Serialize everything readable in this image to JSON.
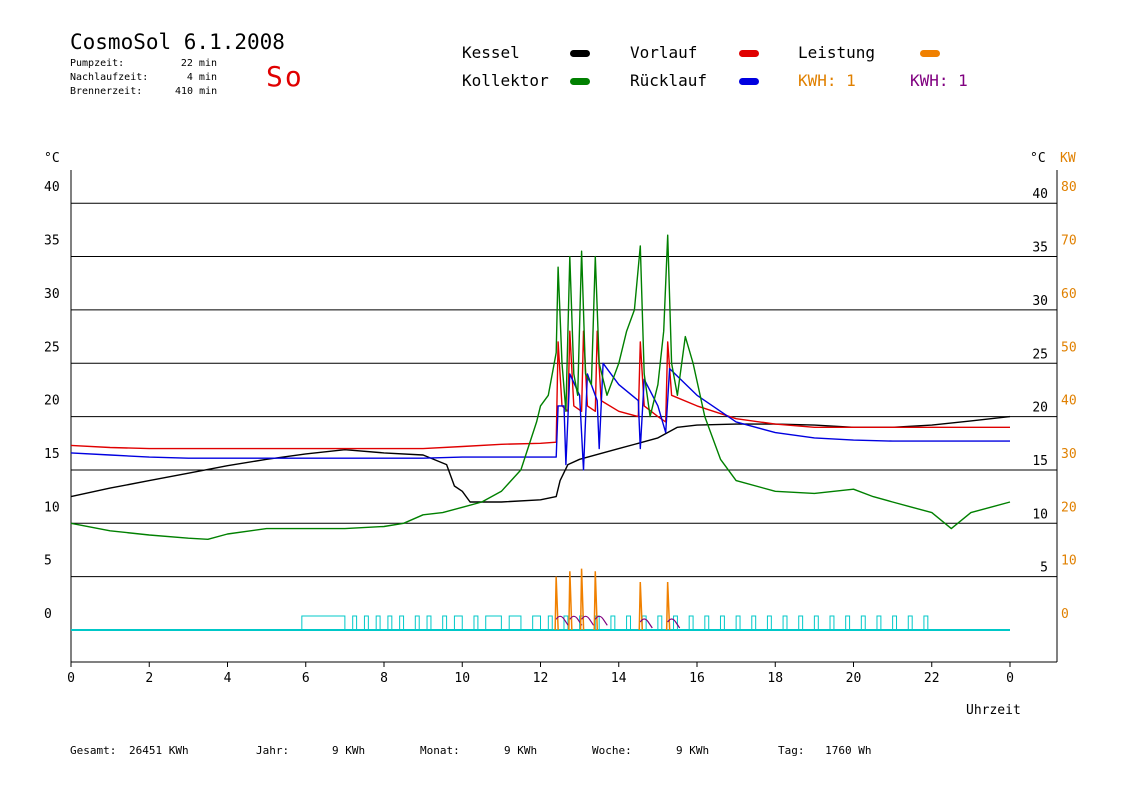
{
  "header": {
    "title": "CosmoSol 6.1.2008",
    "day": "So",
    "stats": [
      {
        "label": "Pumpzeit:",
        "value": "22 min"
      },
      {
        "label": "Nachlaufzeit:",
        "value": "4 min"
      },
      {
        "label": "Brennerzeit:",
        "value": "410 min"
      }
    ]
  },
  "legend": [
    {
      "label": "Kessel",
      "color": "#000000"
    },
    {
      "label": "Vorlauf",
      "color": "#e00000"
    },
    {
      "label": "Leistung",
      "color": "#f08000"
    },
    {
      "label": "Kollektor",
      "color": "#008000"
    },
    {
      "label": "Rücklauf",
      "color": "#0000e0"
    },
    {
      "label": "KWH: 1",
      "color": "#e08000"
    },
    {
      "label": "KWH: 1",
      "color": "#800080"
    }
  ],
  "footer": [
    {
      "label": "Gesamt:",
      "value": "26451 KWh"
    },
    {
      "label": "Jahr:",
      "value": "9 KWh"
    },
    {
      "label": "Monat:",
      "value": "9 KWh"
    },
    {
      "label": "Woche:",
      "value": "9 KWh"
    },
    {
      "label": "Tag:",
      "value": "1760 Wh"
    }
  ],
  "chart_data": {
    "type": "line",
    "xlabel": "Uhrzeit",
    "ylabel_left": "°C",
    "ylabel_right": "°C",
    "ylabel_right2": "KW",
    "xlim": [
      0,
      24
    ],
    "ylim": [
      0,
      45
    ],
    "x_ticks": [
      "0",
      "2",
      "4",
      "6",
      "8",
      "10",
      "12",
      "14",
      "16",
      "18",
      "20",
      "22",
      "0"
    ],
    "y_ticks": [
      0,
      5,
      10,
      15,
      20,
      25,
      30,
      35,
      40
    ],
    "y_right_ticks": [
      5,
      10,
      15,
      20,
      25,
      30,
      35,
      40
    ],
    "y_right2_ticks": [
      0,
      10,
      20,
      30,
      40,
      50,
      60,
      70,
      80
    ],
    "grid": "horizontal",
    "series": [
      {
        "name": "Kessel",
        "color": "#000000",
        "points": [
          [
            0,
            12.5
          ],
          [
            1,
            13.3
          ],
          [
            2,
            14.0
          ],
          [
            3,
            14.7
          ],
          [
            4,
            15.4
          ],
          [
            5,
            16.0
          ],
          [
            6,
            16.5
          ],
          [
            7,
            16.9
          ],
          [
            8,
            16.6
          ],
          [
            9,
            16.4
          ],
          [
            9.6,
            15.5
          ],
          [
            9.8,
            13.5
          ],
          [
            10,
            13.0
          ],
          [
            10.2,
            12.0
          ],
          [
            11,
            12.0
          ],
          [
            12,
            12.2
          ],
          [
            12.4,
            12.5
          ],
          [
            12.5,
            14.0
          ],
          [
            12.7,
            15.5
          ],
          [
            13,
            16.0
          ],
          [
            13.5,
            16.5
          ],
          [
            14,
            17.0
          ],
          [
            14.5,
            17.5
          ],
          [
            15,
            18.0
          ],
          [
            15.5,
            19.0
          ],
          [
            16,
            19.2
          ],
          [
            17,
            19.3
          ],
          [
            18,
            19.3
          ],
          [
            19,
            19.2
          ],
          [
            20,
            19.0
          ],
          [
            21,
            19.0
          ],
          [
            22,
            19.2
          ],
          [
            23,
            19.6
          ],
          [
            24,
            20.0
          ]
        ]
      },
      {
        "name": "Vorlauf",
        "color": "#e00000",
        "points": [
          [
            0,
            17.3
          ],
          [
            1,
            17.1
          ],
          [
            2,
            17.0
          ],
          [
            3,
            17.0
          ],
          [
            4,
            17.0
          ],
          [
            5,
            17.0
          ],
          [
            6,
            17.0
          ],
          [
            7,
            17.0
          ],
          [
            8,
            17.0
          ],
          [
            9,
            17.0
          ],
          [
            10,
            17.2
          ],
          [
            11,
            17.4
          ],
          [
            12,
            17.5
          ],
          [
            12.4,
            17.6
          ],
          [
            12.45,
            27.0
          ],
          [
            12.55,
            21.0
          ],
          [
            12.7,
            20.5
          ],
          [
            12.75,
            28.0
          ],
          [
            12.85,
            21.0
          ],
          [
            13.05,
            20.5
          ],
          [
            13.1,
            28.0
          ],
          [
            13.2,
            21.0
          ],
          [
            13.4,
            20.5
          ],
          [
            13.45,
            28.0
          ],
          [
            13.55,
            21.5
          ],
          [
            14,
            20.5
          ],
          [
            14.5,
            20.0
          ],
          [
            14.55,
            27.0
          ],
          [
            14.65,
            21.0
          ],
          [
            15,
            20.0
          ],
          [
            15.2,
            19.5
          ],
          [
            15.25,
            27.0
          ],
          [
            15.35,
            22.0
          ],
          [
            16,
            21.0
          ],
          [
            17,
            19.8
          ],
          [
            18,
            19.3
          ],
          [
            19,
            19.0
          ],
          [
            20,
            19.0
          ],
          [
            21,
            19.0
          ],
          [
            22,
            19.0
          ],
          [
            23,
            19.0
          ],
          [
            24,
            19.0
          ]
        ]
      },
      {
        "name": "Rücklauf",
        "color": "#0000e0",
        "points": [
          [
            0,
            16.6
          ],
          [
            1,
            16.4
          ],
          [
            2,
            16.2
          ],
          [
            3,
            16.1
          ],
          [
            4,
            16.1
          ],
          [
            5,
            16.1
          ],
          [
            6,
            16.1
          ],
          [
            7,
            16.1
          ],
          [
            8,
            16.1
          ],
          [
            9,
            16.1
          ],
          [
            10,
            16.2
          ],
          [
            11,
            16.2
          ],
          [
            12,
            16.2
          ],
          [
            12.4,
            16.2
          ],
          [
            12.45,
            21.0
          ],
          [
            12.6,
            21.0
          ],
          [
            12.65,
            15.5
          ],
          [
            12.75,
            24.0
          ],
          [
            13,
            22.0
          ],
          [
            13.1,
            15.0
          ],
          [
            13.2,
            24.0
          ],
          [
            13.45,
            21.5
          ],
          [
            13.5,
            17.0
          ],
          [
            13.6,
            25.0
          ],
          [
            14,
            23.0
          ],
          [
            14.5,
            21.5
          ],
          [
            14.55,
            17.0
          ],
          [
            14.65,
            23.5
          ],
          [
            15,
            21.0
          ],
          [
            15.2,
            18.5
          ],
          [
            15.3,
            24.5
          ],
          [
            16,
            22.0
          ],
          [
            17,
            19.5
          ],
          [
            18,
            18.5
          ],
          [
            19,
            18.0
          ],
          [
            20,
            17.8
          ],
          [
            21,
            17.7
          ],
          [
            22,
            17.7
          ],
          [
            23,
            17.7
          ],
          [
            24,
            17.7
          ]
        ]
      },
      {
        "name": "Kollektor",
        "color": "#008000",
        "points": [
          [
            0,
            10.0
          ],
          [
            1,
            9.3
          ],
          [
            2,
            8.9
          ],
          [
            3,
            8.6
          ],
          [
            3.5,
            8.5
          ],
          [
            4,
            9.0
          ],
          [
            5,
            9.5
          ],
          [
            6,
            9.5
          ],
          [
            7,
            9.5
          ],
          [
            8,
            9.7
          ],
          [
            8.5,
            10.0
          ],
          [
            9,
            10.8
          ],
          [
            9.5,
            11.0
          ],
          [
            10,
            11.5
          ],
          [
            10.5,
            12.0
          ],
          [
            11,
            13.0
          ],
          [
            11.5,
            15.0
          ],
          [
            11.9,
            19.5
          ],
          [
            12,
            21.0
          ],
          [
            12.2,
            22.0
          ],
          [
            12.4,
            26.0
          ],
          [
            12.45,
            34.0
          ],
          [
            12.55,
            25.0
          ],
          [
            12.65,
            20.5
          ],
          [
            12.75,
            35.0
          ],
          [
            12.85,
            24.0
          ],
          [
            12.95,
            22.0
          ],
          [
            13.05,
            35.5
          ],
          [
            13.15,
            24.0
          ],
          [
            13.3,
            23.0
          ],
          [
            13.4,
            35.0
          ],
          [
            13.5,
            25.0
          ],
          [
            13.7,
            22.0
          ],
          [
            14,
            25.0
          ],
          [
            14.2,
            28.0
          ],
          [
            14.4,
            30.0
          ],
          [
            14.55,
            36.0
          ],
          [
            14.65,
            24.0
          ],
          [
            14.8,
            20.0
          ],
          [
            15,
            23.0
          ],
          [
            15.15,
            28.0
          ],
          [
            15.25,
            37.0
          ],
          [
            15.35,
            25.0
          ],
          [
            15.5,
            22.0
          ],
          [
            15.7,
            27.5
          ],
          [
            15.9,
            25.0
          ],
          [
            16.2,
            20.0
          ],
          [
            16.6,
            16.0
          ],
          [
            17,
            14.0
          ],
          [
            18,
            13.0
          ],
          [
            19,
            12.8
          ],
          [
            20,
            13.2
          ],
          [
            20.5,
            12.5
          ],
          [
            21,
            12.0
          ],
          [
            21.5,
            11.5
          ],
          [
            22,
            11.0
          ],
          [
            22.5,
            9.5
          ],
          [
            23,
            11.0
          ],
          [
            23.5,
            11.5
          ],
          [
            24,
            12.0
          ]
        ]
      }
    ],
    "power_spikes_kw": [
      {
        "x": 12.4,
        "leistung": 10,
        "kwh": 4
      },
      {
        "x": 12.75,
        "leistung": 11,
        "kwh": 4
      },
      {
        "x": 13.05,
        "leistung": 11.5,
        "kwh": 4
      },
      {
        "x": 13.4,
        "leistung": 11,
        "kwh": 4
      },
      {
        "x": 14.55,
        "leistung": 9,
        "kwh": 3
      },
      {
        "x": 15.25,
        "leistung": 9,
        "kwh": 3
      }
    ],
    "pump_baseline_color": "#00c8c8",
    "pump_pulses": [
      [
        5.9,
        7.0
      ],
      [
        7.2,
        7.3
      ],
      [
        7.5,
        7.6
      ],
      [
        7.8,
        7.9
      ],
      [
        8.1,
        8.2
      ],
      [
        8.4,
        8.5
      ],
      [
        8.8,
        8.9
      ],
      [
        9.1,
        9.2
      ],
      [
        9.5,
        9.6
      ],
      [
        9.8,
        10.0
      ],
      [
        10.3,
        10.4
      ],
      [
        10.6,
        11.0
      ],
      [
        11.2,
        11.5
      ],
      [
        11.8,
        12.0
      ],
      [
        12.2,
        12.3
      ],
      [
        12.6,
        12.7
      ],
      [
        13.0,
        13.1
      ],
      [
        13.4,
        13.5
      ],
      [
        13.8,
        13.9
      ],
      [
        14.2,
        14.3
      ],
      [
        14.6,
        14.7
      ],
      [
        15.0,
        15.1
      ],
      [
        15.4,
        15.5
      ],
      [
        15.8,
        15.9
      ],
      [
        16.2,
        16.3
      ],
      [
        16.6,
        16.7
      ],
      [
        17.0,
        17.1
      ],
      [
        17.4,
        17.5
      ],
      [
        17.8,
        17.9
      ],
      [
        18.2,
        18.3
      ],
      [
        18.6,
        18.7
      ],
      [
        19.0,
        19.1
      ],
      [
        19.4,
        19.5
      ],
      [
        19.8,
        19.9
      ],
      [
        20.2,
        20.3
      ],
      [
        20.6,
        20.7
      ],
      [
        21.0,
        21.1
      ],
      [
        21.4,
        21.5
      ],
      [
        21.8,
        21.9
      ]
    ]
  }
}
